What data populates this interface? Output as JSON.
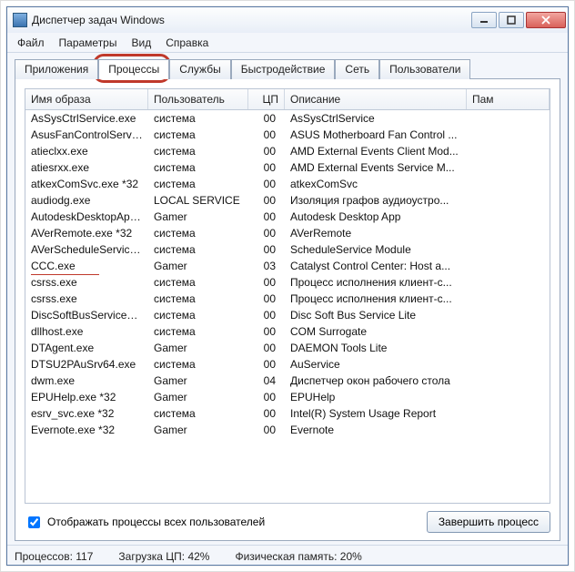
{
  "window": {
    "title": "Диспетчер задач Windows"
  },
  "menu": {
    "file": "Файл",
    "options": "Параметры",
    "view": "Вид",
    "help": "Справка"
  },
  "tabs": {
    "applications": "Приложения",
    "processes": "Процессы",
    "services": "Службы",
    "performance": "Быстродействие",
    "network": "Сеть",
    "users": "Пользователи"
  },
  "columns": {
    "image": "Имя образа",
    "user": "Пользователь",
    "cpu": "ЦП",
    "desc": "Описание",
    "mem": "Пам"
  },
  "rows": [
    {
      "image": "AsSysCtrlService.exe",
      "user": "система",
      "cpu": "00",
      "desc": "AsSysCtrlService"
    },
    {
      "image": "AsusFanControlServi...",
      "user": "система",
      "cpu": "00",
      "desc": "ASUS Motherboard Fan Control ..."
    },
    {
      "image": "atieclxx.exe",
      "user": "система",
      "cpu": "00",
      "desc": "AMD External Events Client Mod..."
    },
    {
      "image": "atiesrxx.exe",
      "user": "система",
      "cpu": "00",
      "desc": "AMD External Events Service M..."
    },
    {
      "image": "atkexComSvc.exe *32",
      "user": "система",
      "cpu": "00",
      "desc": "atkexComSvc"
    },
    {
      "image": "audiodg.exe",
      "user": "LOCAL SERVICE",
      "cpu": "00",
      "desc": "Изоляция графов аудиоустро..."
    },
    {
      "image": "AutodeskDesktopApp...",
      "user": "Gamer",
      "cpu": "00",
      "desc": "Autodesk Desktop App"
    },
    {
      "image": "AVerRemote.exe *32",
      "user": "система",
      "cpu": "00",
      "desc": "AVerRemote"
    },
    {
      "image": "AVerScheduleService....",
      "user": "система",
      "cpu": "00",
      "desc": "ScheduleService Module"
    },
    {
      "image": "CCC.exe",
      "user": "Gamer",
      "cpu": "03",
      "desc": "Catalyst Control Center: Host a..."
    },
    {
      "image": "csrss.exe",
      "user": "система",
      "cpu": "00",
      "desc": "Процесс исполнения клиент-с..."
    },
    {
      "image": "csrss.exe",
      "user": "система",
      "cpu": "00",
      "desc": "Процесс исполнения клиент-с..."
    },
    {
      "image": "DiscSoftBusServiceLit...",
      "user": "система",
      "cpu": "00",
      "desc": "Disc Soft Bus Service Lite"
    },
    {
      "image": "dllhost.exe",
      "user": "система",
      "cpu": "00",
      "desc": "COM Surrogate"
    },
    {
      "image": "DTAgent.exe",
      "user": "Gamer",
      "cpu": "00",
      "desc": "DAEMON Tools Lite"
    },
    {
      "image": "DTSU2PAuSrv64.exe",
      "user": "система",
      "cpu": "00",
      "desc": "AuService"
    },
    {
      "image": "dwm.exe",
      "user": "Gamer",
      "cpu": "04",
      "desc": "Диспетчер окон рабочего стола"
    },
    {
      "image": "EPUHelp.exe *32",
      "user": "Gamer",
      "cpu": "00",
      "desc": "EPUHelp"
    },
    {
      "image": "esrv_svc.exe *32",
      "user": "система",
      "cpu": "00",
      "desc": "Intel(R) System Usage Report"
    },
    {
      "image": "Evernote.exe *32",
      "user": "Gamer",
      "cpu": "00",
      "desc": "Evernote"
    }
  ],
  "checkbox": {
    "label": "Отображать процессы всех пользователей"
  },
  "button": {
    "end": "Завершить процесс"
  },
  "status": {
    "procs_label": "Процессов:",
    "procs_val": "117",
    "cpu_label": "Загрузка ЦП:",
    "cpu_val": "42%",
    "mem_label": "Физическая память:",
    "mem_val": "20%"
  },
  "highlight": {
    "target_tab": "processes",
    "underline_row": 9
  }
}
